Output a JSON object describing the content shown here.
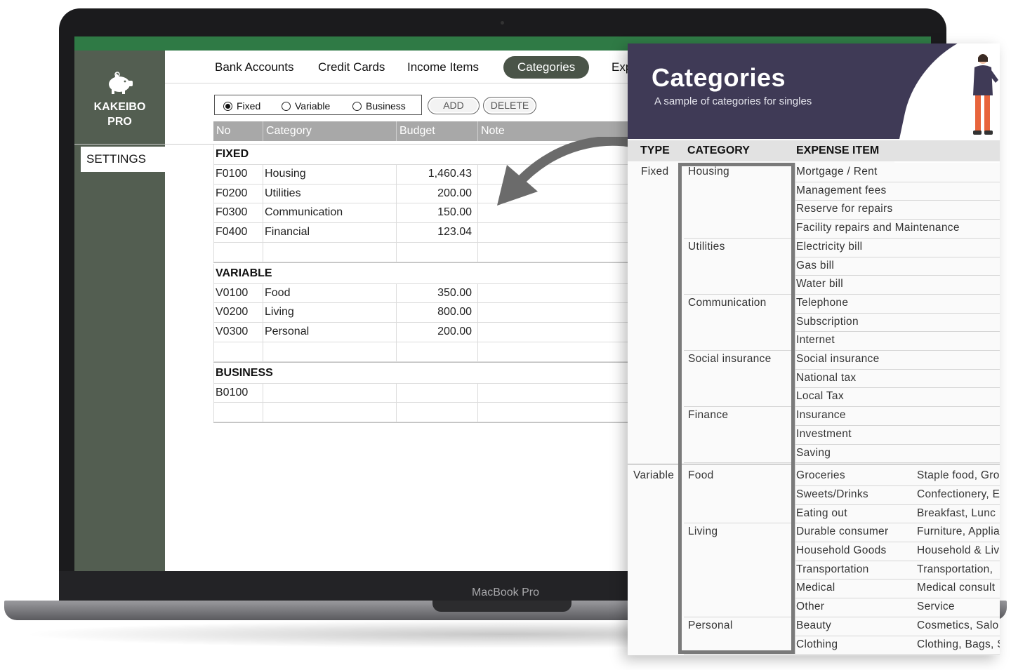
{
  "device": {
    "label": "MacBook Pro"
  },
  "app": {
    "name": "KAKEIBO PRO",
    "name_line1": "KAKEIBO",
    "name_line2": "PRO",
    "logo_icon": "piggy-bank-icon",
    "sidebar_item": "SETTINGS",
    "tabs": [
      "Bank Accounts",
      "Credit Cards",
      "Income Items",
      "Categories",
      "Exp"
    ],
    "active_tab": "Categories",
    "type_options": [
      "Fixed",
      "Variable",
      "Business"
    ],
    "selected_type": "Fixed",
    "add_label": "ADD",
    "delete_label": "DELETE",
    "columns": [
      "No",
      "Category",
      "Budget",
      "Note"
    ],
    "sections": [
      {
        "title": "FIXED",
        "rows": [
          {
            "no": "F0100",
            "category": "Housing",
            "budget": "1,460.43"
          },
          {
            "no": "F0200",
            "category": "Utilities",
            "budget": "200.00"
          },
          {
            "no": "F0300",
            "category": "Communication",
            "budget": "150.00"
          },
          {
            "no": "F0400",
            "category": "Financial",
            "budget": "123.04"
          }
        ]
      },
      {
        "title": "VARIABLE",
        "rows": [
          {
            "no": "V0100",
            "category": "Food",
            "budget": "350.00"
          },
          {
            "no": "V0200",
            "category": "Living",
            "budget": "800.00"
          },
          {
            "no": "V0300",
            "category": "Personal",
            "budget": "200.00"
          }
        ]
      },
      {
        "title": "BUSINESS",
        "rows": [
          {
            "no": "B0100",
            "category": "",
            "budget": ""
          }
        ]
      }
    ],
    "colors": {
      "sidebar": "#535e51",
      "topbar": "#2f7a45",
      "active_tab": "#4a5448",
      "grid_header": "#a8a8a8"
    }
  },
  "card": {
    "title": "Categories",
    "subtitle": "A sample of categories for singles",
    "headers": {
      "type": "TYPE",
      "category": "CATEGORY",
      "item": "EXPENSE ITEM"
    },
    "groups": [
      {
        "type": "Fixed",
        "categories": [
          {
            "name": "Housing",
            "items": [
              {
                "item": "Mortgage / Rent",
                "detail": ""
              },
              {
                "item": "Management fees",
                "detail": ""
              },
              {
                "item": "Reserve for repairs",
                "detail": ""
              },
              {
                "item": "Facility repairs and Maintenance",
                "detail": ""
              }
            ]
          },
          {
            "name": "Utilities",
            "items": [
              {
                "item": "Electricity bill",
                "detail": ""
              },
              {
                "item": "Gas bill",
                "detail": ""
              },
              {
                "item": "Water bill",
                "detail": ""
              }
            ]
          },
          {
            "name": "Communication",
            "items": [
              {
                "item": "Telephone",
                "detail": ""
              },
              {
                "item": "Subscription",
                "detail": ""
              },
              {
                "item": "Internet",
                "detail": ""
              }
            ]
          },
          {
            "name": "Social insurance",
            "items": [
              {
                "item": "Social insurance",
                "detail": ""
              },
              {
                "item": "National tax",
                "detail": ""
              },
              {
                "item": "Local Tax",
                "detail": ""
              }
            ]
          },
          {
            "name": "Finance",
            "items": [
              {
                "item": "Insurance",
                "detail": ""
              },
              {
                "item": "Investment",
                "detail": ""
              },
              {
                "item": "Saving",
                "detail": ""
              }
            ]
          }
        ]
      },
      {
        "type": "Variable",
        "categories": [
          {
            "name": "Food",
            "items": [
              {
                "item": "Groceries",
                "detail": "Staple food, Gro"
              },
              {
                "item": "Sweets/Drinks",
                "detail": "Confectionery, E"
              },
              {
                "item": "Eating out",
                "detail": "Breakfast, Lunc"
              }
            ]
          },
          {
            "name": "Living",
            "items": [
              {
                "item": "Durable consumer",
                "detail": "Furniture, Applia"
              },
              {
                "item": "Household Goods",
                "detail": "Household & Liv"
              },
              {
                "item": "Transportation",
                "detail": "Transportation,"
              },
              {
                "item": "Medical",
                "detail": "Medical consult"
              },
              {
                "item": "Other",
                "detail": "Service"
              }
            ]
          },
          {
            "name": "Personal",
            "items": [
              {
                "item": "Beauty",
                "detail": "Cosmetics, Salo"
              },
              {
                "item": "Clothing",
                "detail": "Clothing, Bags, S"
              }
            ]
          }
        ]
      }
    ],
    "colors": {
      "header": "#3f3a56",
      "highlight_box": "#7a7a7a"
    }
  }
}
